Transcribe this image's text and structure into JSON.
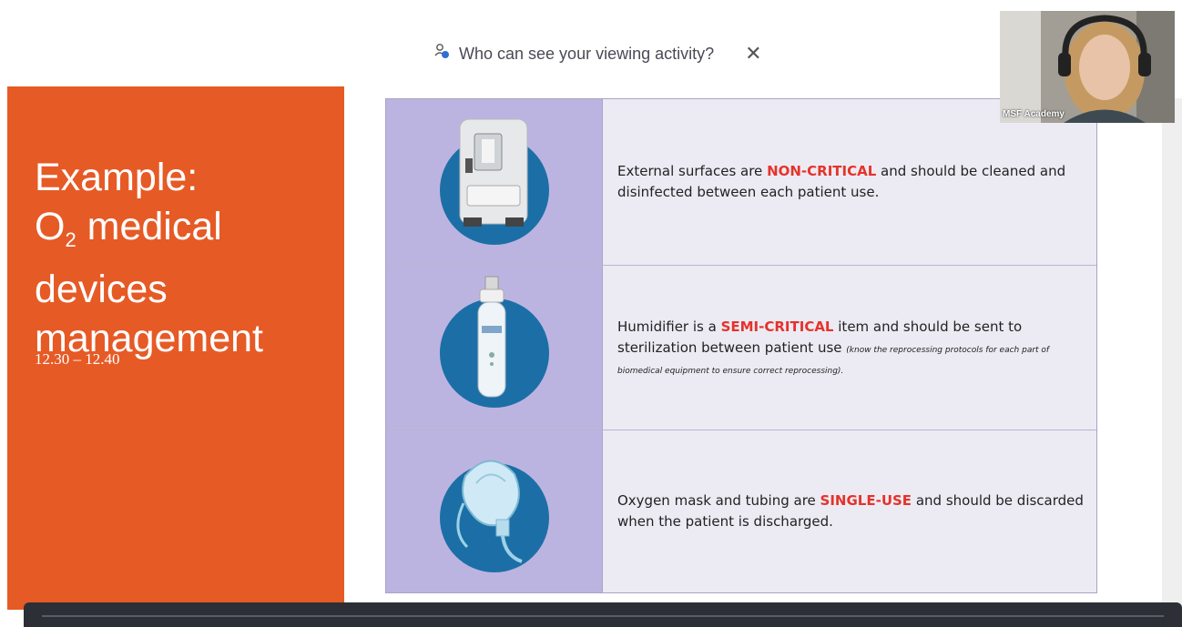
{
  "notice": {
    "text": "Who can see your viewing activity?",
    "close_glyph": "✕",
    "icon": "people-icon"
  },
  "slide": {
    "title_line1": "Example:",
    "title_o": "O",
    "title_sub": "2",
    "title_line2_rest": " medical",
    "title_line3": "devices",
    "title_line4": "management",
    "time": "12.30 – 12.40",
    "accent_color": "#e65a26"
  },
  "table": {
    "rows": [
      {
        "image": "oxygen-concentrator-image",
        "pre": "External surfaces are ",
        "highlight": "NON-CRITICAL",
        "post": " and should be cleaned and disinfected between each patient use.",
        "note": ""
      },
      {
        "image": "humidifier-image",
        "pre": "Humidifier is a ",
        "highlight": "SEMI-CRITICAL",
        "post": " item and should be sent to sterilization between patient use ",
        "note": "(know the reprocessing protocols for each part of biomedical equipment to ensure correct reprocessing)."
      },
      {
        "image": "oxygen-mask-image",
        "pre": "Oxygen mask and tubing are ",
        "highlight": "SINGLE-USE",
        "post": " and should be discarded when the patient is discharged.",
        "note": ""
      }
    ],
    "highlight_color": "#e5332a"
  },
  "webcam": {
    "label": "MSF Academy"
  }
}
